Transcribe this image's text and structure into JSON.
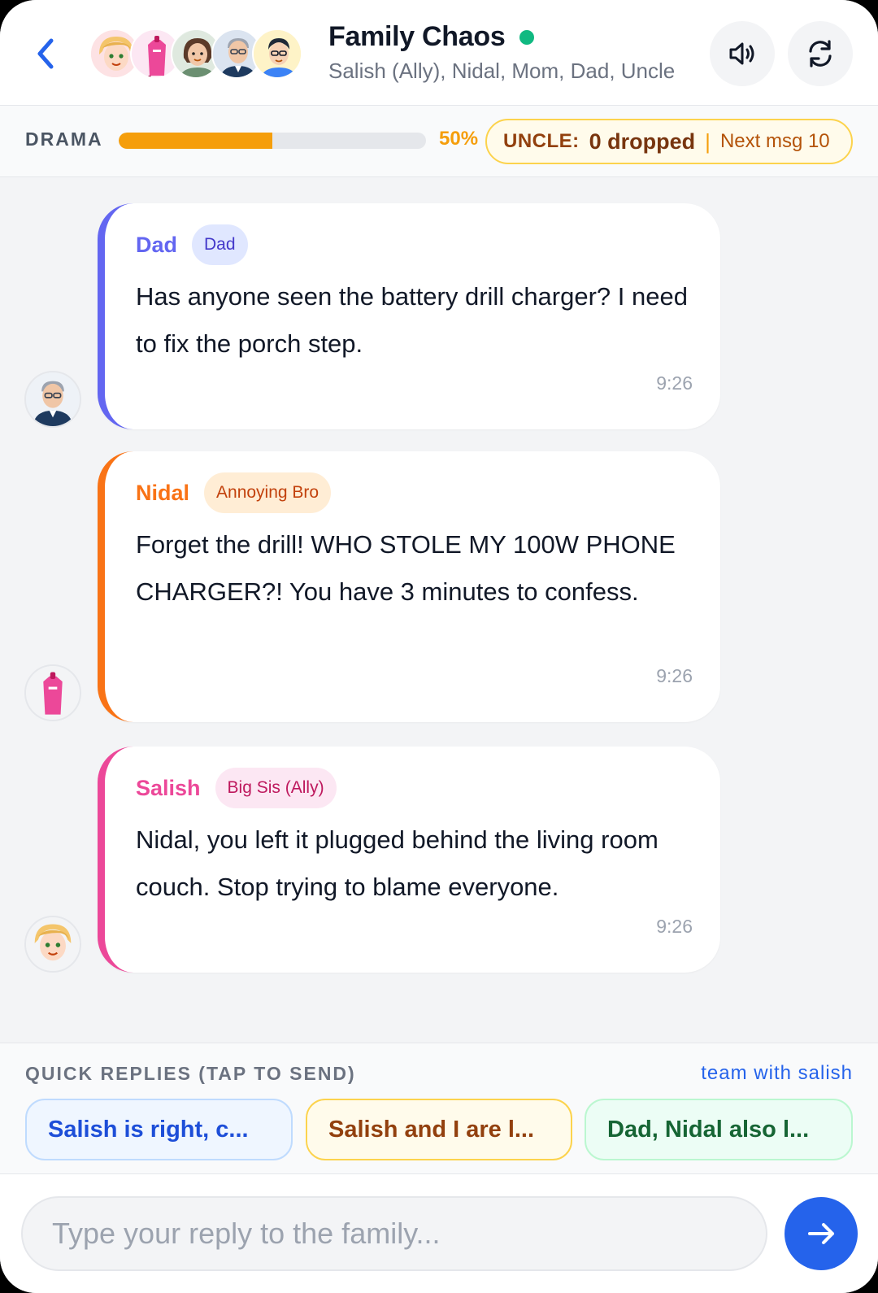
{
  "header": {
    "title": "Family Chaos",
    "members": "Salish (Ally), Nidal, Mom, Dad, Uncle",
    "online": true,
    "avatars": [
      "salish",
      "nidal",
      "mom",
      "dad",
      "uncle"
    ]
  },
  "drama": {
    "label": "DRAMA",
    "progress": 0.5,
    "percent_text": "50%",
    "uncle_label": "UNCLE:",
    "uncle_dropped": "0 dropped",
    "next_msg": "Next msg 10"
  },
  "messages": [
    {
      "sender": "Dad",
      "role": "Dad",
      "text": "Has anyone seen the battery drill charger? I need to fix the porch step.",
      "time": "9:26",
      "accent": "#6366f1"
    },
    {
      "sender": "Nidal",
      "role": "Annoying Bro",
      "text": "Forget the drill! WHO STOLE MY 100W PHONE CHARGER?! You have 3 minutes to confess.",
      "time": "9:26",
      "accent": "#f97316"
    },
    {
      "sender": "Salish",
      "role": "Big Sis (Ally)",
      "text": "Nidal, you left it plugged behind the living room couch. Stop trying to blame everyone.",
      "time": "9:26",
      "accent": "#ec4899"
    }
  ],
  "quick_replies": {
    "title": "QUICK REPLIES (TAP TO SEND)",
    "team_link": "team with salish",
    "options": [
      "Salish is right, c...",
      "Salish and I are l...",
      "Dad, Nidal also l..."
    ]
  },
  "composer": {
    "placeholder": "Type your reply to the family..."
  },
  "colors": {
    "accent_blue": "#2563eb",
    "drama_orange": "#f59e0b",
    "online_green": "#10b981"
  }
}
